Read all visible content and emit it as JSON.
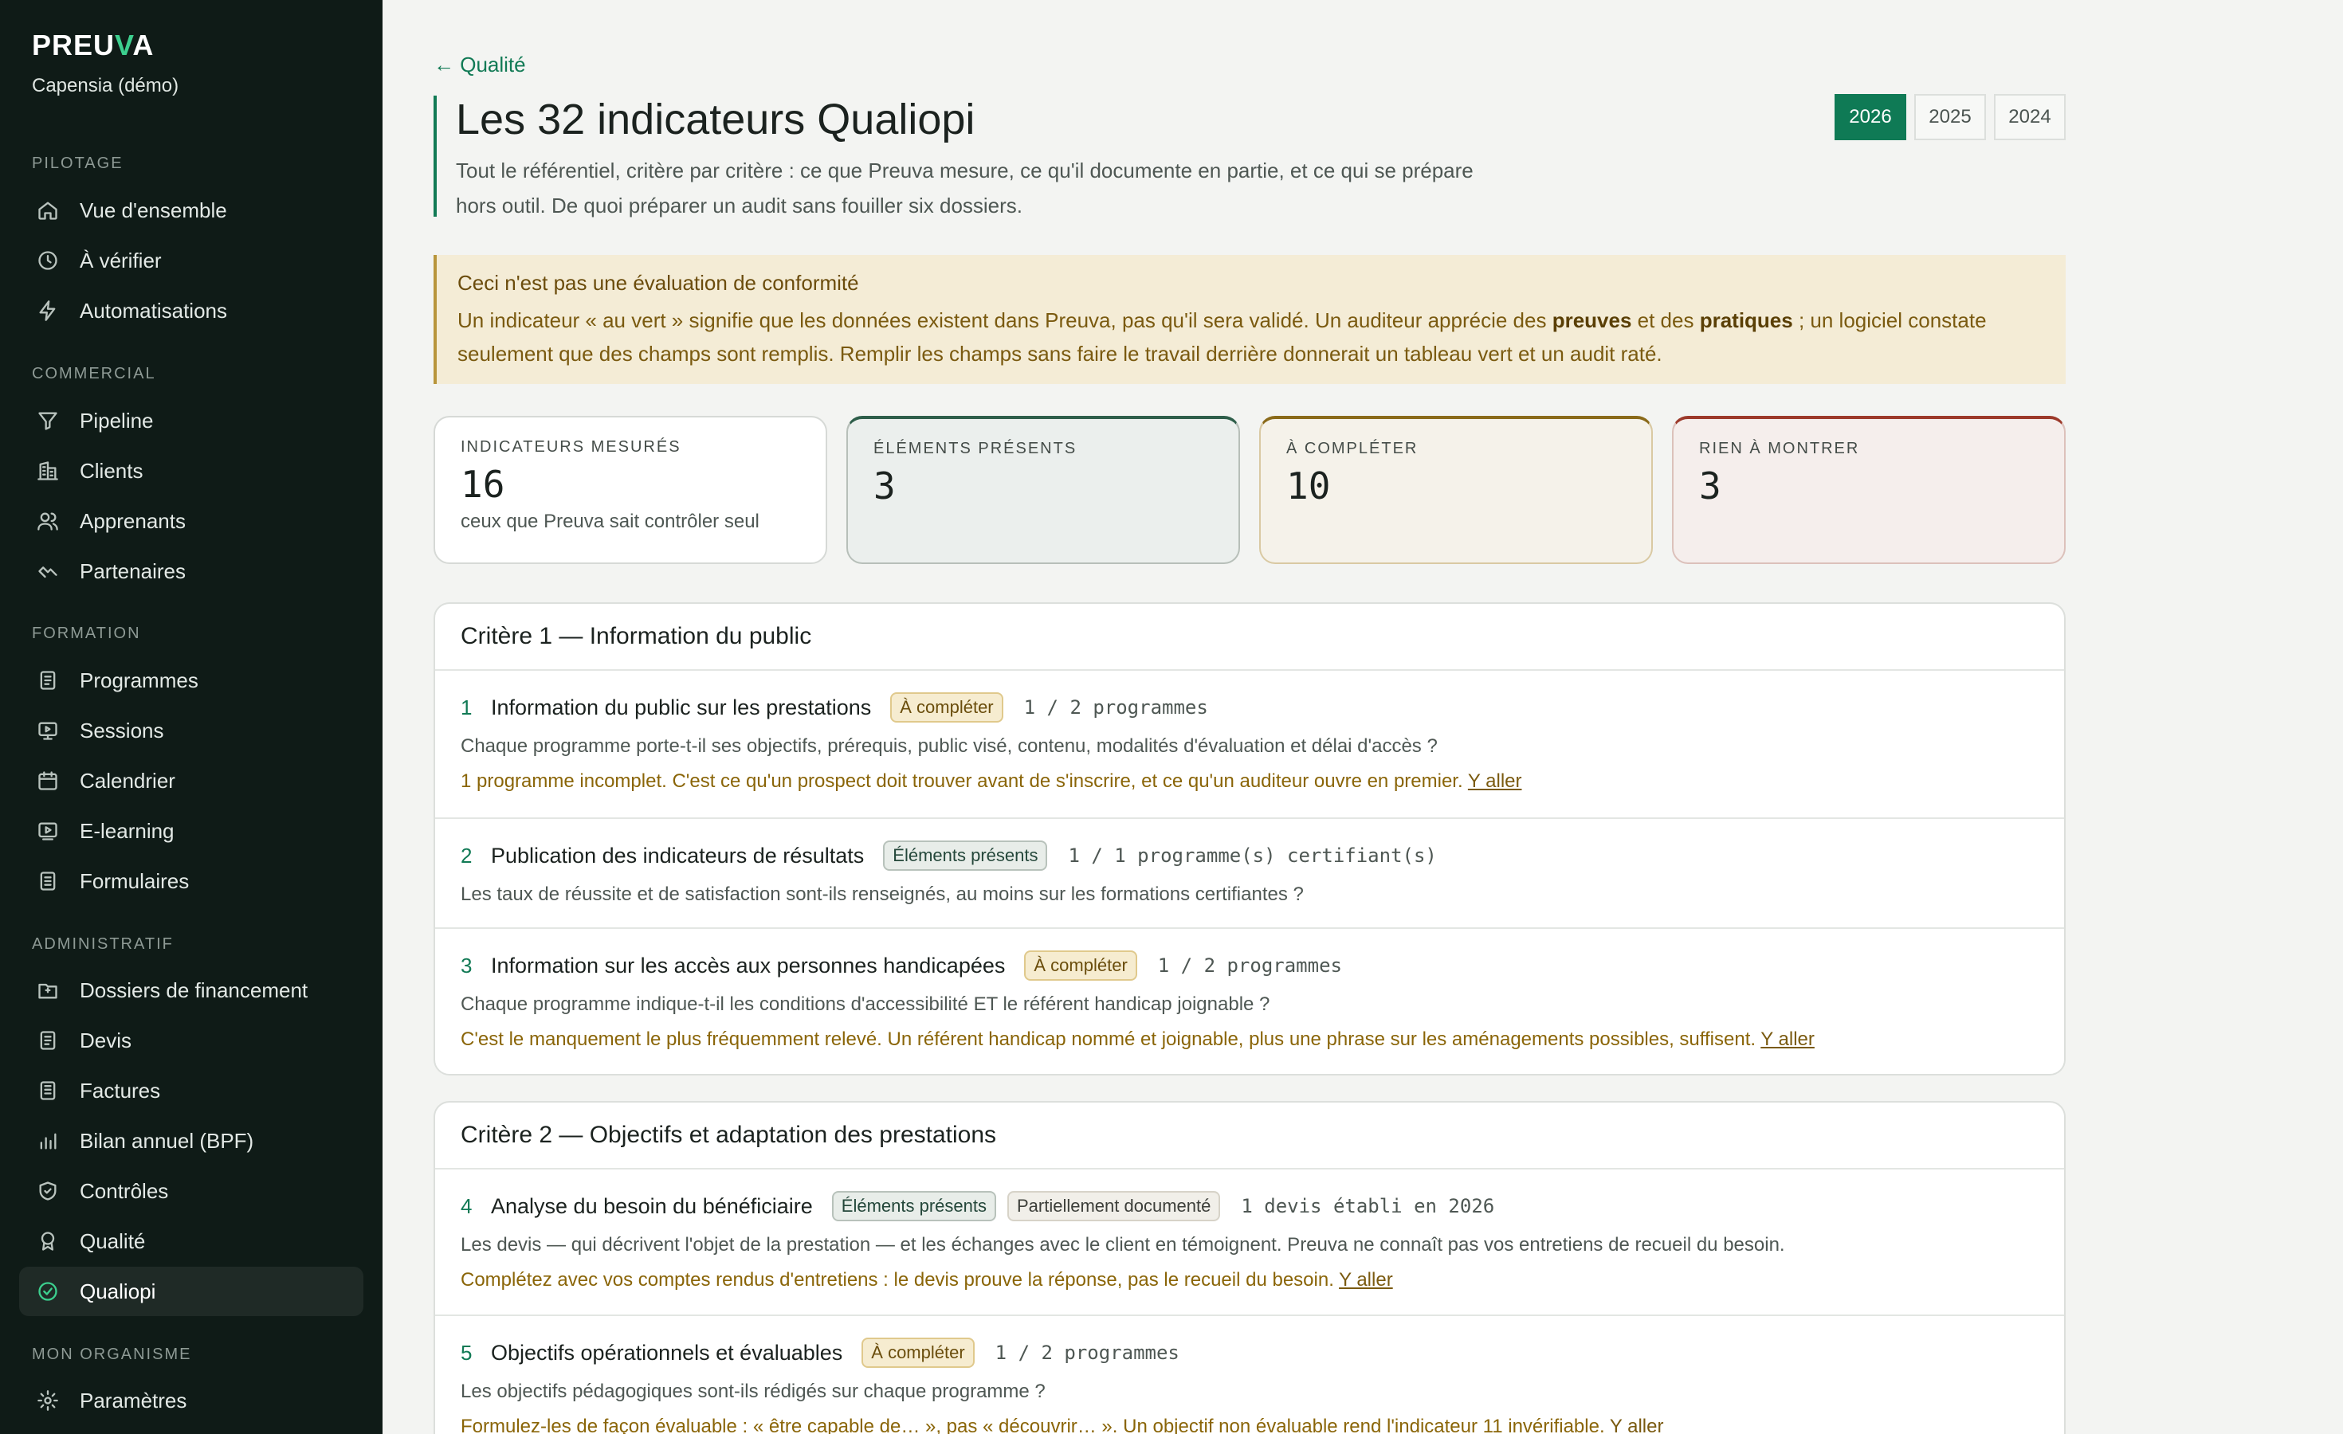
{
  "brand": {
    "prefix": "PREU",
    "accent": "V",
    "suffix": "A"
  },
  "org": "Capensia (démo)",
  "nav": {
    "sections": [
      {
        "label": "PILOTAGE",
        "items": [
          {
            "label": "Vue d'ensemble",
            "icon": "home-icon"
          },
          {
            "label": "À vérifier",
            "icon": "clock-icon"
          },
          {
            "label": "Automatisations",
            "icon": "bolt-icon"
          }
        ]
      },
      {
        "label": "COMMERCIAL",
        "items": [
          {
            "label": "Pipeline",
            "icon": "filter-icon"
          },
          {
            "label": "Clients",
            "icon": "building-icon"
          },
          {
            "label": "Apprenants",
            "icon": "users-icon"
          },
          {
            "label": "Partenaires",
            "icon": "handshake-icon"
          }
        ]
      },
      {
        "label": "FORMATION",
        "items": [
          {
            "label": "Programmes",
            "icon": "document-icon"
          },
          {
            "label": "Sessions",
            "icon": "screen-icon"
          },
          {
            "label": "Calendrier",
            "icon": "calendar-icon"
          },
          {
            "label": "E-learning",
            "icon": "play-icon"
          },
          {
            "label": "Formulaires",
            "icon": "form-icon"
          }
        ]
      },
      {
        "label": "ADMINISTRATIF",
        "items": [
          {
            "label": "Dossiers de financement",
            "icon": "folder-icon"
          },
          {
            "label": "Devis",
            "icon": "document-icon"
          },
          {
            "label": "Factures",
            "icon": "invoice-icon"
          },
          {
            "label": "Bilan annuel (BPF)",
            "icon": "bar-chart-icon"
          },
          {
            "label": "Contrôles",
            "icon": "shield-icon"
          },
          {
            "label": "Qualité",
            "icon": "award-icon"
          },
          {
            "label": "Qualiopi",
            "icon": "check-circle-icon",
            "active": true
          }
        ]
      },
      {
        "label": "MON ORGANISME",
        "items": [
          {
            "label": "Paramètres",
            "icon": "gear-icon"
          }
        ]
      }
    ]
  },
  "page": {
    "back": "← Qualité",
    "title": "Les 32 indicateurs Qualiopi",
    "subtitle": "Tout le référentiel, critère par critère : ce que Preuva mesure, ce qu'il documente en partie, et ce qui se prépare hors outil. De quoi préparer un audit sans fouiller six dossiers.",
    "years": [
      "2026",
      "2025",
      "2024"
    ],
    "active_year": "2026"
  },
  "warning": {
    "title": "Ceci n'est pas une évaluation de conformité",
    "text_a": "Un indicateur « au vert » signifie que les données existent dans Preuva, pas qu'il sera validé. Un auditeur apprécie des ",
    "bold_a": "preuves",
    "text_b": " et des ",
    "bold_b": "pratiques",
    "text_c": " ; un logiciel constate seulement que des champs sont remplis. Remplir les champs sans faire le travail derrière donnerait un tableau vert et un audit raté."
  },
  "stats": [
    {
      "label": "INDICATEURS MESURÉS",
      "value": "16",
      "sub": "ceux que Preuva sait contrôler seul",
      "tone": "neutral"
    },
    {
      "label": "ÉLÉMENTS PRÉSENTS",
      "value": "3",
      "sub": "",
      "tone": "green"
    },
    {
      "label": "À COMPLÉTER",
      "value": "10",
      "sub": "",
      "tone": "amber"
    },
    {
      "label": "RIEN À MONTRER",
      "value": "3",
      "sub": "",
      "tone": "red"
    }
  ],
  "criteria": [
    {
      "title": "Critère 1 — Information du public",
      "indicators": [
        {
          "num": "1",
          "title": "Information du public sur les prestations",
          "badges": [
            {
              "label": "À compléter",
              "tone": "amber"
            }
          ],
          "meta": "1 / 2 programmes",
          "desc": "Chaque programme porte-t-il ses objectifs, prérequis, public visé, contenu, modalités d'évaluation et délai d'accès ?",
          "note": "1 programme incomplet. C'est ce qu'un prospect doit trouver avant de s'inscrire, et ce qu'un auditeur ouvre en premier.",
          "link": "Y aller"
        },
        {
          "num": "2",
          "title": "Publication des indicateurs de résultats",
          "badges": [
            {
              "label": "Éléments présents",
              "tone": "green"
            }
          ],
          "meta": "1 / 1 programme(s) certifiant(s)",
          "desc": "Les taux de réussite et de satisfaction sont-ils renseignés, au moins sur les formations certifiantes ?",
          "note": "",
          "link": ""
        },
        {
          "num": "3",
          "title": "Information sur les accès aux personnes handicapées",
          "badges": [
            {
              "label": "À compléter",
              "tone": "amber"
            }
          ],
          "meta": "1 / 2 programmes",
          "desc": "Chaque programme indique-t-il les conditions d'accessibilité ET le référent handicap joignable ?",
          "note": "C'est le manquement le plus fréquemment relevé. Un référent handicap nommé et joignable, plus une phrase sur les aménagements possibles, suffisent.",
          "link": "Y aller"
        }
      ]
    },
    {
      "title": "Critère 2 — Objectifs et adaptation des prestations",
      "indicators": [
        {
          "num": "4",
          "title": "Analyse du besoin du bénéficiaire",
          "badges": [
            {
              "label": "Éléments présents",
              "tone": "green"
            },
            {
              "label": "Partiellement documenté",
              "tone": "grey"
            }
          ],
          "meta": "1 devis établi en 2026",
          "desc": "Les devis — qui décrivent l'objet de la prestation — et les échanges avec le client en témoignent. Preuva ne connaît pas vos entretiens de recueil du besoin.",
          "note": "Complétez avec vos comptes rendus d'entretiens : le devis prouve la réponse, pas le recueil du besoin.",
          "link": "Y aller"
        },
        {
          "num": "5",
          "title": "Objectifs opérationnels et évaluables",
          "badges": [
            {
              "label": "À compléter",
              "tone": "amber"
            }
          ],
          "meta": "1 / 2 programmes",
          "desc": "Les objectifs pédagogiques sont-ils rédigés sur chaque programme ?",
          "note": "Formulez-les de façon évaluable : « être capable de… », pas « découvrir… ». Un objectif non évaluable rend l'indicateur 11 invérifiable.",
          "link": "Y aller"
        }
      ]
    }
  ]
}
